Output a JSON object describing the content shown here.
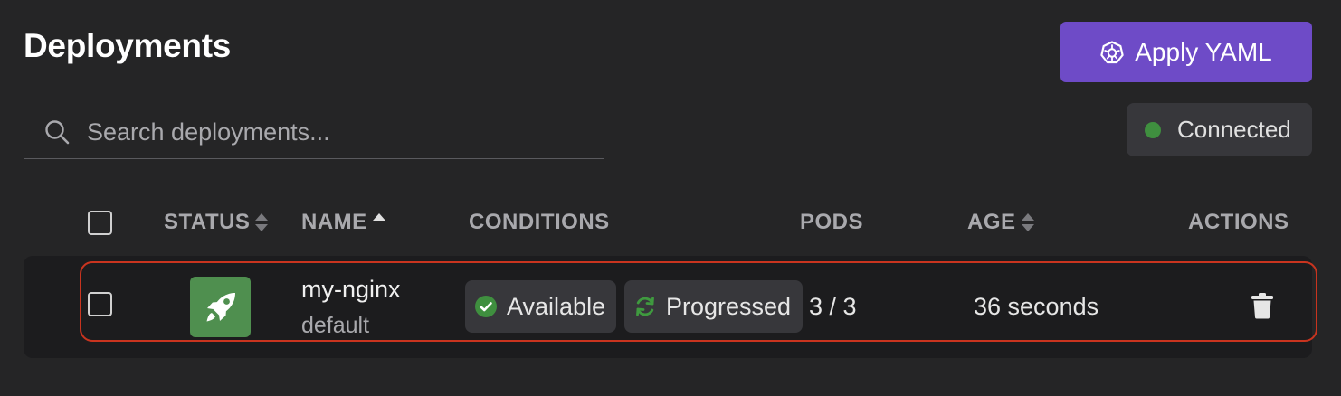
{
  "header": {
    "title": "Deployments",
    "apply_label": "Apply YAML"
  },
  "search": {
    "placeholder": "Search deployments..."
  },
  "connection": {
    "label": "Connected",
    "status_color": "#3f8f3f"
  },
  "table": {
    "columns": {
      "status": "STATUS",
      "name": "NAME",
      "conditions": "CONDITIONS",
      "pods": "PODS",
      "age": "AGE",
      "actions": "ACTIONS"
    },
    "sorted_column": "name",
    "sort_direction": "ascending",
    "rows": [
      {
        "status_icon": "rocket-icon",
        "status_color": "#4f8f4f",
        "name": "my-nginx",
        "namespace": "default",
        "conditions": [
          {
            "label": "Available",
            "icon": "check-circle-icon"
          },
          {
            "label": "Progressed",
            "icon": "refresh-icon"
          }
        ],
        "pods": "3 / 3",
        "age": "36 seconds",
        "action_icon": "trash-icon",
        "selected": false
      }
    ]
  },
  "colors": {
    "accent": "#6e4bc7",
    "highlight_outline": "#c9341f",
    "success": "#3f8f3f"
  }
}
